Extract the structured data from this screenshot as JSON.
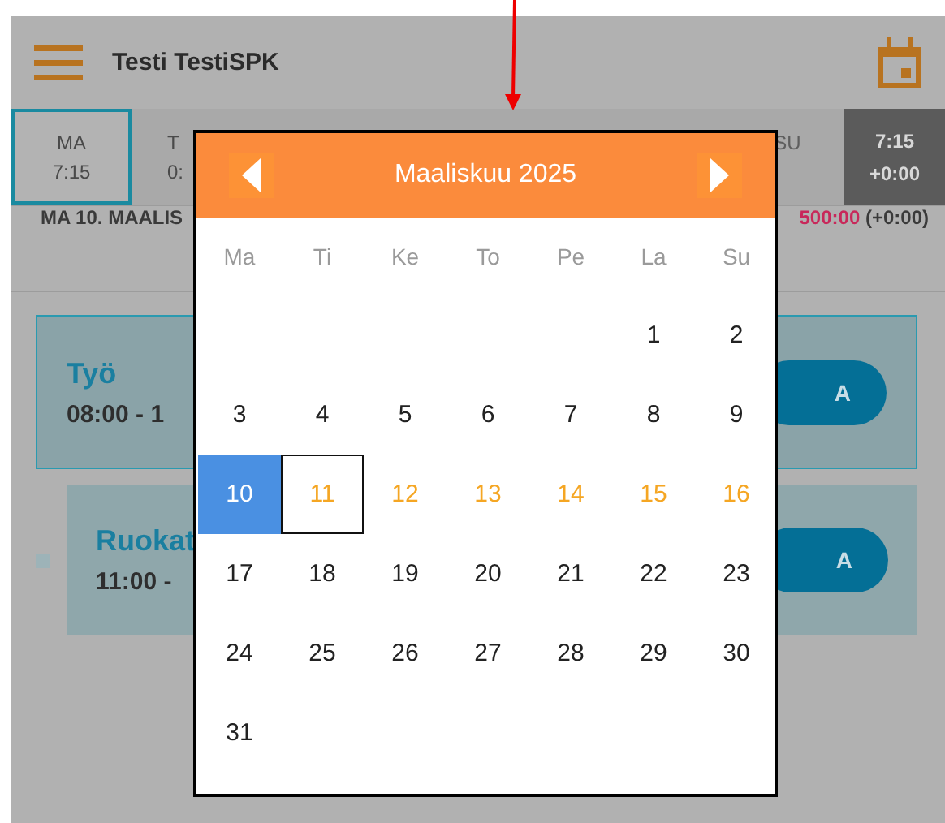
{
  "header": {
    "title": "Testi TestiSPK"
  },
  "day_tabs": [
    {
      "label": "MA",
      "hours": "7:15",
      "selected": true
    },
    {
      "label": "T",
      "hours": "0:",
      "selected": false
    },
    {
      "label": "SU",
      "selected": false
    }
  ],
  "week_total": {
    "hours": "7:15",
    "balance": "+0:00"
  },
  "date_bar": {
    "date": "MA 10. MAALIS",
    "total": "500:00",
    "balance": "(+0:00)"
  },
  "entries": [
    {
      "kind": "work",
      "title": "Työ",
      "time": "08:00 - 1",
      "button": "A"
    },
    {
      "kind": "break",
      "title": "Ruokat",
      "time": "11:00 -",
      "button": "A"
    }
  ],
  "calendar": {
    "month": "Maaliskuu 2025",
    "weekdays": [
      "Ma",
      "Ti",
      "Ke",
      "To",
      "Pe",
      "La",
      "Su"
    ],
    "weeks": [
      {
        "days": [
          {
            "label": "1",
            "selected": false,
            "focused": false,
            "in_week": false
          },
          {
            "label": "2",
            "selected": false,
            "focused": false,
            "in_week": false
          }
        ]
      },
      {
        "days": [
          {
            "label": "3",
            "selected": false,
            "focused": false,
            "in_week": false
          },
          {
            "label": "4",
            "selected": false,
            "focused": false,
            "in_week": false
          },
          {
            "label": "5",
            "selected": false,
            "focused": false,
            "in_week": false
          },
          {
            "label": "6",
            "selected": false,
            "focused": false,
            "in_week": false
          },
          {
            "label": "7",
            "selected": false,
            "focused": false,
            "in_week": false
          },
          {
            "label": "8",
            "selected": false,
            "focused": false,
            "in_week": false
          },
          {
            "label": "9",
            "selected": false,
            "focused": false,
            "in_week": false
          }
        ]
      },
      {
        "days": [
          {
            "label": "10",
            "selected": true,
            "focused": false,
            "in_week": false
          },
          {
            "label": "11",
            "selected": false,
            "focused": true,
            "in_week": true
          },
          {
            "label": "12",
            "selected": false,
            "focused": false,
            "in_week": true
          },
          {
            "label": "13",
            "selected": false,
            "focused": false,
            "in_week": true
          },
          {
            "label": "14",
            "selected": false,
            "focused": false,
            "in_week": true
          },
          {
            "label": "15",
            "selected": false,
            "focused": false,
            "in_week": true
          },
          {
            "label": "16",
            "selected": false,
            "focused": false,
            "in_week": true
          }
        ]
      },
      {
        "days": [
          {
            "label": "17",
            "selected": false,
            "focused": false,
            "in_week": false
          },
          {
            "label": "18",
            "selected": false,
            "focused": false,
            "in_week": false
          },
          {
            "label": "19",
            "selected": false,
            "focused": false,
            "in_week": false
          },
          {
            "label": "20",
            "selected": false,
            "focused": false,
            "in_week": false
          },
          {
            "label": "21",
            "selected": false,
            "focused": false,
            "in_week": false
          },
          {
            "label": "22",
            "selected": false,
            "focused": false,
            "in_week": false
          },
          {
            "label": "23",
            "selected": false,
            "focused": false,
            "in_week": false
          }
        ]
      },
      {
        "days": [
          {
            "label": "24",
            "selected": false,
            "focused": false,
            "in_week": false
          },
          {
            "label": "25",
            "selected": false,
            "focused": false,
            "in_week": false
          },
          {
            "label": "26",
            "selected": false,
            "focused": false,
            "in_week": false
          },
          {
            "label": "27",
            "selected": false,
            "focused": false,
            "in_week": false
          },
          {
            "label": "28",
            "selected": false,
            "focused": false,
            "in_week": false
          },
          {
            "label": "29",
            "selected": false,
            "focused": false,
            "in_week": false
          },
          {
            "label": "30",
            "selected": false,
            "focused": false,
            "in_week": false
          }
        ]
      },
      {
        "days": [
          {
            "label": "31",
            "selected": false,
            "focused": false,
            "in_week": false
          }
        ]
      }
    ]
  }
}
